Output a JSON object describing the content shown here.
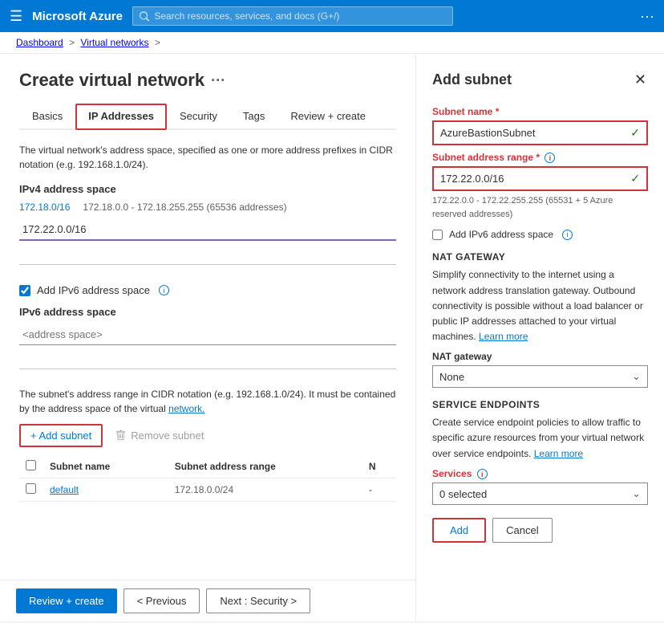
{
  "topbar": {
    "hamburger_icon": "☰",
    "title": "Microsoft Azure",
    "search_placeholder": "Search resources, services, and docs (G+/)",
    "more_icon": "···"
  },
  "breadcrumb": {
    "items": [
      "Dashboard",
      "Virtual networks"
    ],
    "separators": [
      ">",
      ">"
    ]
  },
  "page": {
    "title": "Create virtual network",
    "title_dots": "···"
  },
  "tabs": [
    {
      "label": "Basics",
      "state": "normal"
    },
    {
      "label": "IP Addresses",
      "state": "active"
    },
    {
      "label": "Security",
      "state": "normal"
    },
    {
      "label": "Tags",
      "state": "normal"
    },
    {
      "label": "Review + create",
      "state": "normal"
    }
  ],
  "main": {
    "section_desc": "The virtual network's address space, specified as one or more address prefixes in CIDR notation (e.g. 192.168.1.0/24).",
    "ipv4_label": "IPv4 address space",
    "ipv4_cidr": "172.18.0/16",
    "ipv4_range": "172.18.0.0 - 172.18.255.255 (65536 addresses)",
    "ipv4_input_value": "172.22.0.0/16",
    "ipv4_input2_value": "",
    "checkbox_ipv6_label": "Add IPv6 address space",
    "ipv6_label": "IPv6 address space",
    "ipv6_placeholder": "<address space>",
    "subnet_note": "The subnet's address range in CIDR notation (e.g. 192.168.1.0/24). It must be contained by the address space of the virtual network.",
    "subnet_note_link": "network.",
    "add_subnet_btn": "+ Add subnet",
    "remove_subnet_btn": "Remove subnet",
    "table": {
      "headers": [
        "Subnet name",
        "Subnet address range",
        "N"
      ],
      "rows": [
        {
          "name": "default",
          "range": "172.18.0.0/24",
          "n": "-"
        }
      ]
    }
  },
  "bottombar": {
    "review_create_label": "Review + create",
    "previous_label": "< Previous",
    "next_label": "Next : Security >"
  },
  "side_panel": {
    "title": "Add subnet",
    "close_icon": "✕",
    "subnet_name_label": "Subnet name",
    "subnet_name_required": "*",
    "subnet_name_value": "AzureBastionSubnet",
    "subnet_name_valid": "✓",
    "subnet_address_label": "Subnet address range",
    "subnet_address_required": "*",
    "subnet_address_value": "172.22.0.0/16",
    "subnet_address_valid": "✓",
    "subnet_range_note": "172.22.0.0 - 172.22.255.255 (65531 + 5 Azure reserved addresses)",
    "checkbox_ipv6_label": "Add IPv6 address space",
    "nat_gateway_section": "NAT GATEWAY",
    "nat_gateway_desc": "Simplify connectivity to the internet using a network address translation gateway. Outbound connectivity is possible without a load balancer or public IP addresses attached to your virtual machines.",
    "nat_gateway_learn_more": "Learn more",
    "nat_gateway_label": "NAT gateway",
    "nat_gateway_value": "None",
    "service_endpoints_section": "SERVICE ENDPOINTS",
    "service_endpoints_desc": "Create service endpoint policies to allow traffic to specific azure resources from your virtual network over service endpoints.",
    "service_endpoints_learn_more": "Learn more",
    "services_label": "Services",
    "services_value": "0 selected",
    "add_btn": "Add",
    "cancel_btn": "Cancel"
  }
}
